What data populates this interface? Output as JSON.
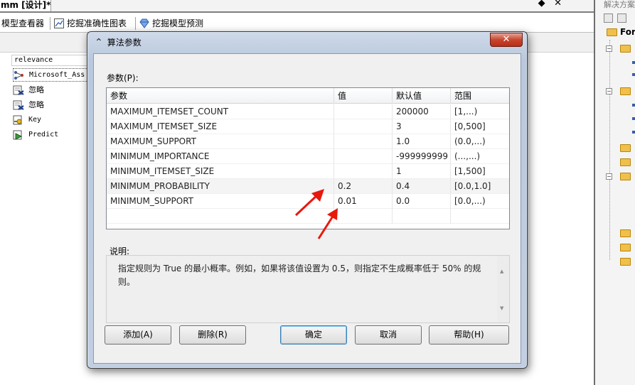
{
  "ide": {
    "doc_tab": "mm [设计]*",
    "toolbar": {
      "model_viewer": "模型查看器",
      "accuracy_chart": "挖掘准确性图表",
      "prediction": "挖掘模型预测"
    },
    "columns_header": "relevance",
    "tree_rows": [
      {
        "label": "Microsoft_Ass",
        "icon": "model-icon"
      },
      {
        "label": "忽略",
        "icon": "ignore-icon"
      },
      {
        "label": "忽略",
        "icon": "ignore-icon"
      },
      {
        "label": "Key",
        "icon": "key-icon"
      },
      {
        "label": "Predict",
        "icon": "predict-icon"
      }
    ],
    "right_panel": {
      "title": "解决方案",
      "root_label": "For"
    }
  },
  "dialog": {
    "title": "算法参数",
    "close_label": "✕",
    "params_label": "参数(P):",
    "columns": {
      "name": "参数",
      "value": "值",
      "default": "默认值",
      "range": "范围"
    },
    "rows": [
      {
        "name": "MAXIMUM_ITEMSET_COUNT",
        "value": "",
        "default": "200000",
        "range": "[1,...)"
      },
      {
        "name": "MAXIMUM_ITEMSET_SIZE",
        "value": "",
        "default": "3",
        "range": "[0,500]"
      },
      {
        "name": "MAXIMUM_SUPPORT",
        "value": "",
        "default": "1.0",
        "range": "(0.0,...)"
      },
      {
        "name": "MINIMUM_IMPORTANCE",
        "value": "",
        "default": "-999999999",
        "range": "(...,...)"
      },
      {
        "name": "MINIMUM_ITEMSET_SIZE",
        "value": "",
        "default": "1",
        "range": "[1,500]"
      },
      {
        "name": "MINIMUM_PROBABILITY",
        "value": "0.2",
        "default": "0.4",
        "range": "[0.0,1.0]"
      },
      {
        "name": "MINIMUM_SUPPORT",
        "value": "0.01",
        "default": "0.0",
        "range": "[0.0,...)"
      }
    ],
    "description_label": "说明:",
    "description": "指定规则为 True 的最小概率。例如，如果将该值设置为 0.5，则指定不生成概率低于 50% 的规则。",
    "buttons": {
      "add": "添加(A)",
      "delete": "删除(R)",
      "ok": "确定",
      "cancel": "取消",
      "help": "帮助(H)"
    },
    "annotation_color": "#e8180c"
  }
}
